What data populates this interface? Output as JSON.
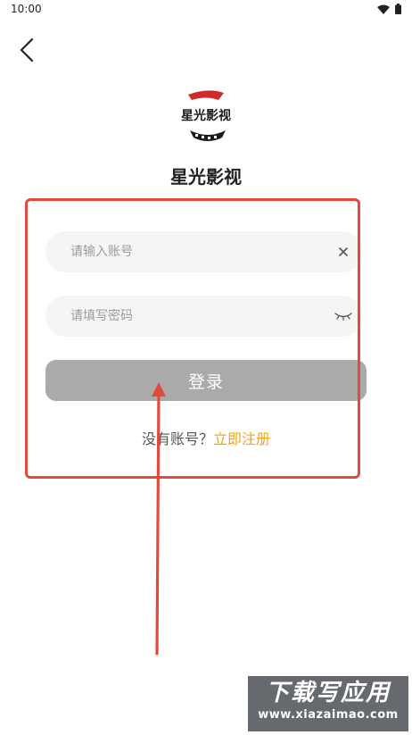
{
  "status_bar": {
    "time": "10:00"
  },
  "app": {
    "title": "星光影视",
    "logo_text": "星光影视"
  },
  "form": {
    "account_placeholder": "请输入账号",
    "password_placeholder": "请填写密码",
    "login_label": "登录",
    "register_prompt": "没有账号？",
    "register_link": "立即注册"
  },
  "watermark": {
    "title": "下载写应用",
    "url": "www.xiazaimao.com"
  },
  "colors": {
    "accent": "#f6a316",
    "annotation": "#e24a3b",
    "button_disabled": "#aaaaaa",
    "field_bg": "#f5f5f5"
  }
}
